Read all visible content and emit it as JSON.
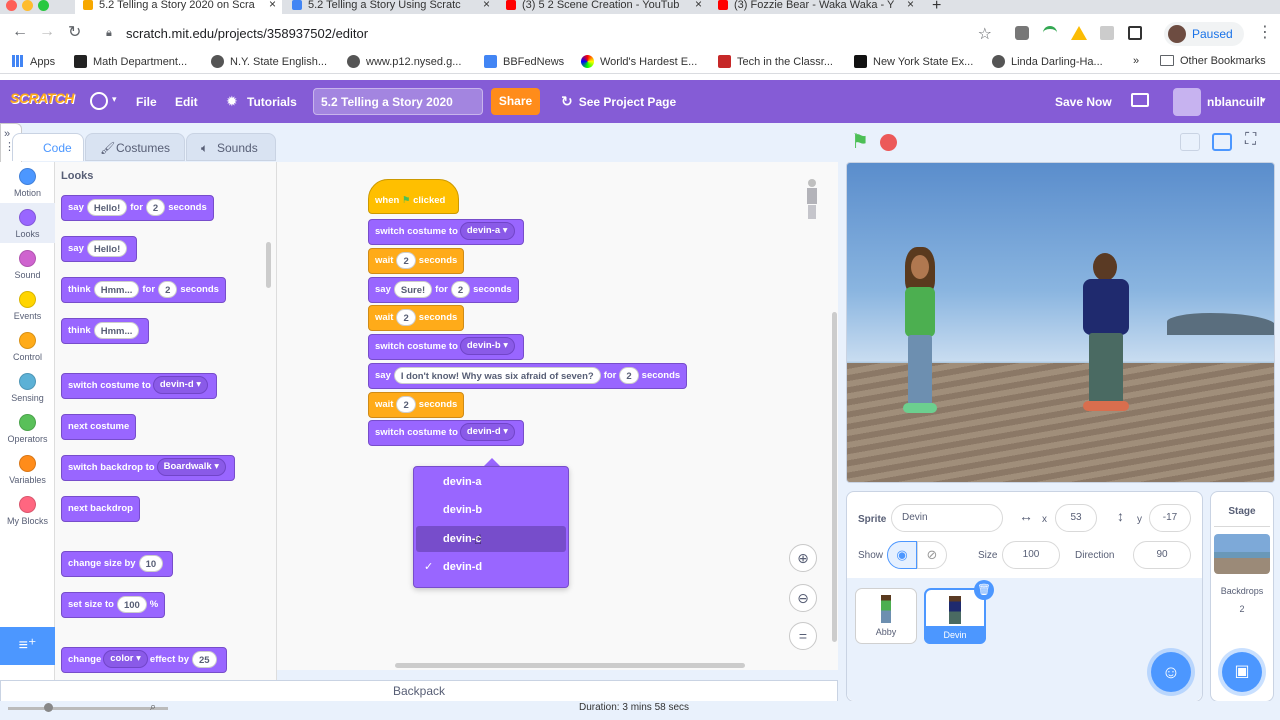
{
  "browser": {
    "tabs": [
      {
        "title": "5.2 Telling a Story 2020 on Scra",
        "active": true,
        "icon_color": "#f7a800"
      },
      {
        "title": "5.2 Telling a Story Using Scratc",
        "active": false,
        "icon_color": "#4285f4"
      },
      {
        "title": "(3) 5 2 Scene Creation - YouTub",
        "active": false,
        "icon_color": "#ff0000"
      },
      {
        "title": "(3) Fozzie Bear - Waka Waka - Y",
        "active": false,
        "icon_color": "#ff0000"
      }
    ],
    "url": "scratch.mit.edu/projects/358937502/editor",
    "profile_label": "Paused",
    "bookmarks": [
      "Apps",
      "Math Department...",
      "N.Y. State English...",
      "www.p12.nysed.g...",
      "BBFedNews",
      "World's Hardest E...",
      "Tech in the Classr...",
      "New York State Ex...",
      "Linda Darling-Ha..."
    ],
    "bookmarks_more": "»",
    "other_bookmarks": "Other Bookmarks"
  },
  "menu": {
    "logo": "SCRATCH",
    "file": "File",
    "edit": "Edit",
    "tutorials": "Tutorials",
    "project_title": "5.2 Telling a Story 2020",
    "share": "Share",
    "see_project_page": "See Project Page",
    "save_now": "Save Now",
    "username": "nblancuill"
  },
  "tabs": {
    "code": "Code",
    "costumes": "Costumes",
    "sounds": "Sounds"
  },
  "categories": [
    {
      "label": "Motion",
      "color": "#4c97ff"
    },
    {
      "label": "Looks",
      "color": "#9966ff"
    },
    {
      "label": "Sound",
      "color": "#cf63cf"
    },
    {
      "label": "Events",
      "color": "#ffd500"
    },
    {
      "label": "Control",
      "color": "#ffab19"
    },
    {
      "label": "Sensing",
      "color": "#5cb1d6"
    },
    {
      "label": "Operators",
      "color": "#59c059"
    },
    {
      "label": "Variables",
      "color": "#ff8c1a"
    },
    {
      "label": "My Blocks",
      "color": "#ff6680"
    }
  ],
  "palette": {
    "heading": "Looks",
    "say_for": {
      "say": "say",
      "msg": "Hello!",
      "for": "for",
      "secs": "2",
      "seconds": "seconds"
    },
    "say": {
      "say": "say",
      "msg": "Hello!"
    },
    "think_for": {
      "think": "think",
      "msg": "Hmm...",
      "for": "for",
      "secs": "2",
      "seconds": "seconds"
    },
    "think": {
      "think": "think",
      "msg": "Hmm..."
    },
    "switch_costume": {
      "label": "switch costume to",
      "value": "devin-d"
    },
    "next_costume": "next costume",
    "switch_backdrop": {
      "label": "switch backdrop to",
      "value": "Boardwalk"
    },
    "next_backdrop": "next backdrop",
    "change_size": {
      "label": "change size by",
      "value": "10"
    },
    "set_size": {
      "label": "set size to",
      "value": "100",
      "unit": "%"
    },
    "change_effect": {
      "label": "change",
      "value": "color",
      "by": "effect by",
      "amount": "25"
    }
  },
  "script": {
    "hat": {
      "when": "when",
      "clicked": "clicked"
    },
    "b1": {
      "label": "switch costume to",
      "value": "devin-a"
    },
    "b2": {
      "wait": "wait",
      "value": "2",
      "seconds": "seconds"
    },
    "b3": {
      "say": "say",
      "msg": "Sure!",
      "for": "for",
      "secs": "2",
      "seconds": "seconds"
    },
    "b4": {
      "wait": "wait",
      "value": "2",
      "seconds": "seconds"
    },
    "b5": {
      "label": "switch costume to",
      "value": "devin-b"
    },
    "b6": {
      "say": "say",
      "msg": "I don't know! Why was six afraid of seven?",
      "for": "for",
      "secs": "2",
      "seconds": "seconds"
    },
    "b7": {
      "wait": "wait",
      "value": "2",
      "seconds": "seconds"
    },
    "b8": {
      "label": "switch costume to",
      "value": "devin-d"
    }
  },
  "dropdown": {
    "options": [
      "devin-a",
      "devin-b",
      "devin-c",
      "devin-d"
    ],
    "checked_mark": "✓"
  },
  "sprite_info": {
    "sprite_label": "Sprite",
    "sprite_name": "Devin",
    "x_label": "x",
    "x": "53",
    "y_label": "y",
    "y": "-17",
    "show_label": "Show",
    "size_label": "Size",
    "size": "100",
    "direction_label": "Direction",
    "direction": "90"
  },
  "sprites": [
    {
      "name": "Abby",
      "selected": false
    },
    {
      "name": "Devin",
      "selected": true
    }
  ],
  "stage_panel": {
    "title": "Stage",
    "backdrops_label": "Backdrops",
    "backdrops_count": "2"
  },
  "backpack": "Backpack",
  "status": {
    "duration": "Duration: 3 mins 58 secs"
  }
}
